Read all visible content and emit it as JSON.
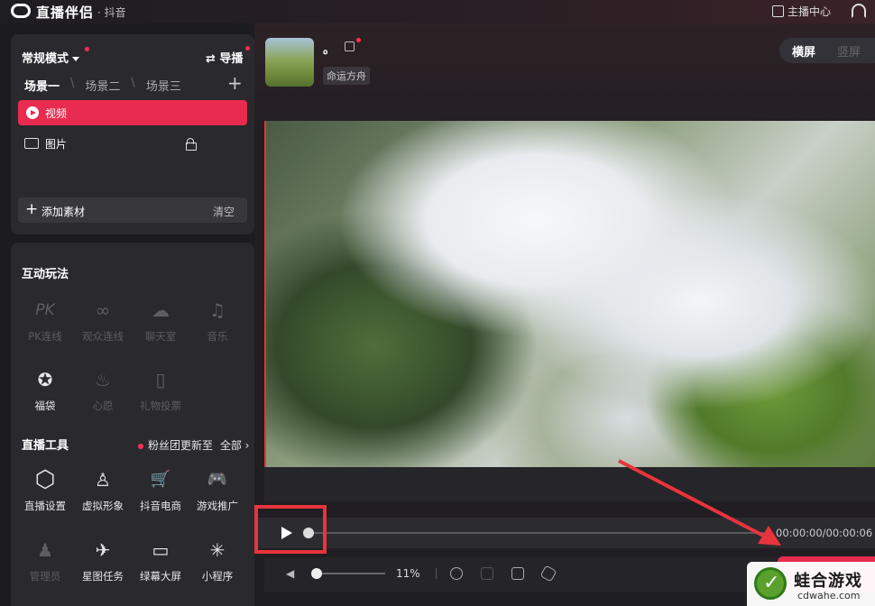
{
  "titlebar": {
    "app_title": "直播伴侣",
    "app_sub": "· 抖音",
    "host_center": "主播中心"
  },
  "scenes_panel": {
    "mode": "常规模式",
    "guide": "导播",
    "tabs": [
      "场景一",
      "场景二",
      "场景三"
    ],
    "sources": [
      {
        "label": "视频",
        "icon": "play-icon",
        "active": true
      },
      {
        "label": "图片",
        "icon": "image-icon",
        "locked": true
      }
    ],
    "add_material": "添加素材",
    "clear": "清空"
  },
  "interactive": {
    "title": "互动玩法",
    "items": [
      {
        "label": "PK连线",
        "glyph": "PK",
        "enabled": false
      },
      {
        "label": "观众连线",
        "glyph": "∞",
        "enabled": false
      },
      {
        "label": "聊天室",
        "glyph": "☁",
        "enabled": false
      },
      {
        "label": "音乐",
        "glyph": "♫",
        "enabled": false
      },
      {
        "label": "福袋",
        "glyph": "✪",
        "enabled": true
      },
      {
        "label": "心愿",
        "glyph": "♨",
        "enabled": false
      },
      {
        "label": "礼物投票",
        "glyph": "▯",
        "enabled": false
      }
    ]
  },
  "live_tools": {
    "title": "直播工具",
    "fans_notice": "粉丝团更新至",
    "all": "全部 ›",
    "items": [
      {
        "label": "直播设置",
        "glyph": "⬡",
        "enabled": true
      },
      {
        "label": "虚拟形象",
        "glyph": "♙",
        "enabled": true
      },
      {
        "label": "抖音电商",
        "glyph": "🛒",
        "enabled": true
      },
      {
        "label": "游戏推广",
        "glyph": "🎮",
        "enabled": true
      },
      {
        "label": "管理员",
        "glyph": "♟",
        "enabled": false
      },
      {
        "label": "星图任务",
        "glyph": "✈",
        "enabled": true
      },
      {
        "label": "绿幕大屏",
        "glyph": "▭",
        "enabled": true
      },
      {
        "label": "小程序",
        "glyph": "✳",
        "enabled": true
      }
    ]
  },
  "profile": {
    "nickname": "。",
    "tag": "命运方舟"
  },
  "orientation": {
    "horizontal": "横屏",
    "vertical": "竖屏"
  },
  "timeline": {
    "time": "00:00:00/00:00:06",
    "progress": 0
  },
  "controls": {
    "volume": "11%",
    "volume_level": 0.11
  },
  "watermark": {
    "title": "蛙合游戏",
    "url": "cdwahe.com"
  },
  "colors": {
    "accent": "#e82b4e",
    "highlight": "#e8343c"
  }
}
